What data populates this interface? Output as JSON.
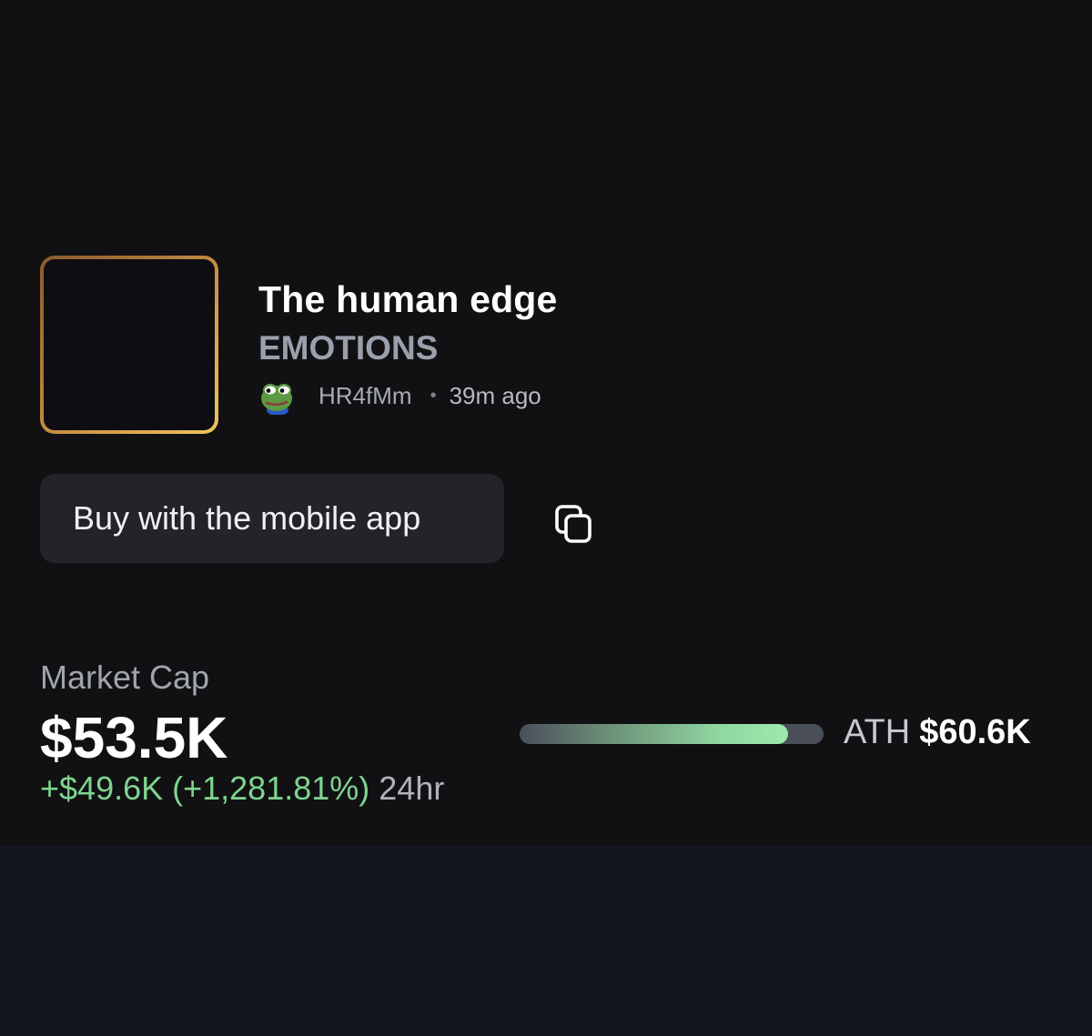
{
  "token": {
    "name": "The human edge",
    "ticker": "EMOTIONS",
    "creator": "HR4fMm",
    "time_ago": "39m ago",
    "avatar_icon": "frog-avatar-icon"
  },
  "actions": {
    "buy_label": "Buy with the mobile app",
    "copy_icon": "copy-icon"
  },
  "market_cap": {
    "label": "Market Cap",
    "value": "$53.5K",
    "change": "+$49.6K (+1,281.81%)",
    "period": "24hr"
  },
  "ath": {
    "label": "ATH",
    "value": "$60.6K",
    "progress_fraction": 0.883
  },
  "colors": {
    "card_background": "#111114",
    "page_background": "#121621",
    "positive": "#7ed48f",
    "image_border_gold": "#d8a24a",
    "button_background": "#232428"
  }
}
